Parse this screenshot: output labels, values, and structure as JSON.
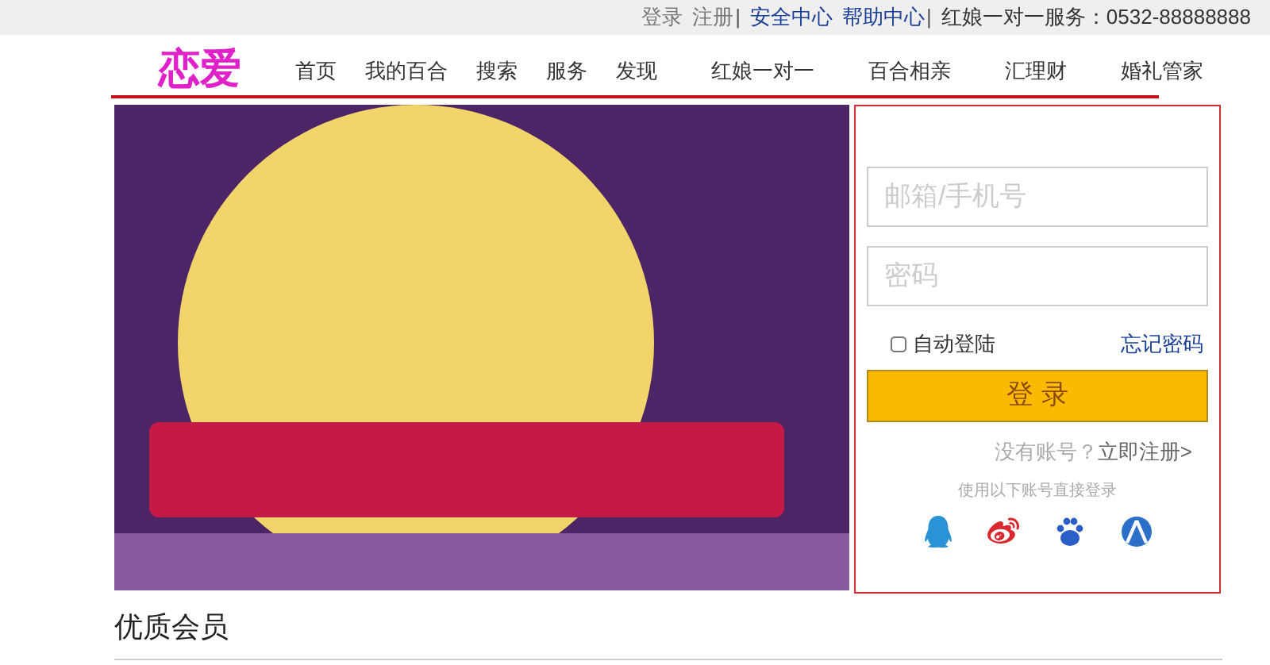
{
  "top_bar": [
    {
      "text": "登录",
      "kind": "muted"
    },
    {
      "text": "注册",
      "kind": "muted"
    },
    {
      "text": "|",
      "kind": "separator"
    },
    {
      "text": "安全中心",
      "kind": "link"
    },
    {
      "text": "帮助中心",
      "kind": "link"
    },
    {
      "text": "|",
      "kind": "separator"
    },
    {
      "text": "红娘一对一服务：0532-88888888",
      "kind": "plain"
    }
  ],
  "logo": "恋爱",
  "nav": [
    "首页",
    "我的百合",
    "搜索",
    "服务",
    "发现",
    "红娘一对一",
    "百合相亲",
    "汇理财",
    "婚礼管家"
  ],
  "login": {
    "account": {
      "placeholder": "邮箱/手机号"
    },
    "password": {
      "placeholder": "密码"
    },
    "remember": {
      "label": "自动登陆",
      "checked": false
    },
    "forgot": "忘记密码",
    "submit": "登 录",
    "no_account": "没有账号？",
    "register": "立即注册>",
    "social_hint": "使用以下账号直接登录"
  },
  "section_title": "优质会员"
}
